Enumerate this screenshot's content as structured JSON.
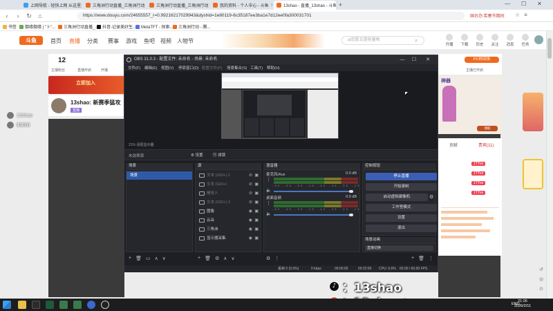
{
  "browser": {
    "tabs": [
      {
        "label": "上网导航 - 轻快上网 从这里开始",
        "color": "#3aa0f0"
      },
      {
        "label": "三角洲行动直播_三角洲行动直播...",
        "color": "#f06a1e"
      },
      {
        "label": "三角洲行动直播_三角洲行动直播",
        "color": "#f06a1e"
      },
      {
        "label": "我的资料 - 个人中心 - 斗鱼",
        "color": "#f06a1e"
      },
      {
        "label": "13shao - 直播_13shao - 斗鱼",
        "color": "#f06a1e"
      }
    ],
    "url": "https://www.douyu.com/24655557_r=0.99216217029943&dyshid=1e80119-6c35187ee3ba1e7d12ee0fa300031701",
    "address_right": "国台办:若春节期间",
    "bookmarks": [
      "书签",
      "御缘御缘 | \"卜\"...",
      "三角洲行动直播_...",
      "抖音-记录美好生...",
      "MetaTFT - 探索...",
      "三角洲行动 - 腾..."
    ]
  },
  "site": {
    "nav": [
      "首页",
      "直播",
      "分类",
      "赛事",
      "游戏",
      "鱼吧",
      "视频",
      "直播间",
      "活动",
      "人物节"
    ],
    "search_placeholder": "ai您愿又提前量呢",
    "header_icons": [
      "开播",
      "下载",
      "历史",
      "关注",
      "消息",
      "任务"
    ],
    "stats": [
      {
        "value": "12",
        "label": "主播粉丝"
      },
      {
        "value": "",
        "label": "直播开启"
      },
      {
        "value": "",
        "label": "开播"
      }
    ],
    "streamer_title": "13shao: 新赛季猛攻",
    "badge": "直播",
    "banner_text": "立即加入",
    "chat_users": [
      "13shao",
      "ⅢⅢⅢⅢ"
    ],
    "right_panel": {
      "top_badge": "PC时间场",
      "label": "主播已开启",
      "side_banner": "神器",
      "tabs": [
        "贡献",
        "贵宾(11)"
      ],
      "chat_lines": [
        "1TYxx",
        "1TYxx",
        "1TYxx",
        "1TYxx"
      ]
    }
  },
  "obs": {
    "title": "OBS 31.0.3 - 配置文件: 未命名 - 场景: 未命名",
    "menu": [
      "文件(F)",
      "编辑(E)",
      "视图(V)",
      "停靠窗口(D)",
      "配置文件(P)",
      "场景集合(S)",
      "工具(T)",
      "帮助(H)"
    ],
    "sub_label": "21%   请把显示器",
    "source_selected": "未选择源",
    "btn_props": "设置",
    "btn_filters": "滤镜",
    "docks": {
      "scenes": "场景",
      "sources": "源",
      "mixer": "混音器",
      "controls": "控制按钮",
      "transitions": "场景动画"
    },
    "scene_items": [
      "场景"
    ],
    "sources": [
      "文本 (GDI+) 2",
      "文本 (GDI+)",
      "睡觉人",
      "文本 (GDI+) 3",
      "图像",
      "云朵",
      "三角洲",
      "显示器采集"
    ],
    "mixer": [
      {
        "name": "麦克风/Aux",
        "db": "0.0 dB",
        "level": 0.92
      },
      {
        "name": "桌面音频",
        "db": "0.0 dB",
        "level": 0.92
      }
    ],
    "mixer_scale": "-60 -55 -50 -45 -40 -35 -30 -25 -20 -15 -10 -5 0",
    "controls": [
      "停止直播",
      "开始录制",
      "启动虚拟摄像机",
      "工作室模式",
      "设置",
      "退出"
    ],
    "transition_value": "直接切换",
    "status": {
      "dropped": "丢帧 0 (0.0%)",
      "kbps": "0 kbps",
      "rec": "00:00:00",
      "live": "00:22:50",
      "cpu": "CPU: 0.6%",
      "fps": "60.00 / 60.00 FPS"
    }
  },
  "overlay": {
    "douyin": "：13shao",
    "kuaishou": "：13shao丶"
  },
  "taskbar": {
    "time": "21:26",
    "date": "2026/2/11",
    "lang": "ENG"
  }
}
